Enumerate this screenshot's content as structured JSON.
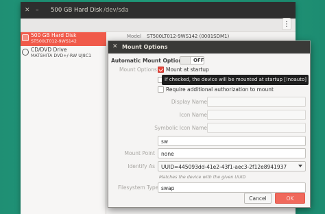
{
  "disks_window": {
    "title": "500 GB Hard Disk",
    "subtitle": "/dev/sda",
    "menu_glyph": "⋮",
    "model_label": "Model",
    "model_value": "ST500LT012-9WS142 (0001SDM1)",
    "devices": [
      {
        "name": "500 GB Hard Disk",
        "sub": "ST500LT012-9WS142",
        "selected": true,
        "icon": "hard-disk-icon"
      },
      {
        "name": "CD/DVD Drive",
        "sub": "MATSHITA DVD+/-RW UJ8C1",
        "selected": false,
        "icon": "optical-drive-icon"
      }
    ]
  },
  "dialog": {
    "title": "Mount Options",
    "close_glyph": "✕",
    "automatic_label": "Automatic Mount Options",
    "toggle_state": "OFF",
    "mount_options_label": "Mount Options",
    "mount_at_startup": "Mount at startup",
    "tooltip": "If checked, the device will be mounted at startup [!noauto]",
    "require_auth": "Require additional authorization to mount",
    "display_name_label": "Display Name",
    "icon_name_label": "Icon Name",
    "symbolic_icon_label": "Symbolic Icon Name",
    "options_value": "sw",
    "mount_point_label": "Mount Point",
    "mount_point_value": "none",
    "identify_as_label": "Identify As",
    "identify_as_value": "UUID=445093dd-41e2-43f1-aec3-2f12e8941937",
    "identify_hint": "Matches the device with the given UUID",
    "fs_type_label": "Filesystem Type",
    "fs_type_value": "swap",
    "cancel_label": "Cancel",
    "ok_label": "OK"
  },
  "colors": {
    "accent": "#e8463b",
    "selection": "#f05a4a",
    "titlebar": "#2e2e2e",
    "desktop": "#22a07f"
  }
}
